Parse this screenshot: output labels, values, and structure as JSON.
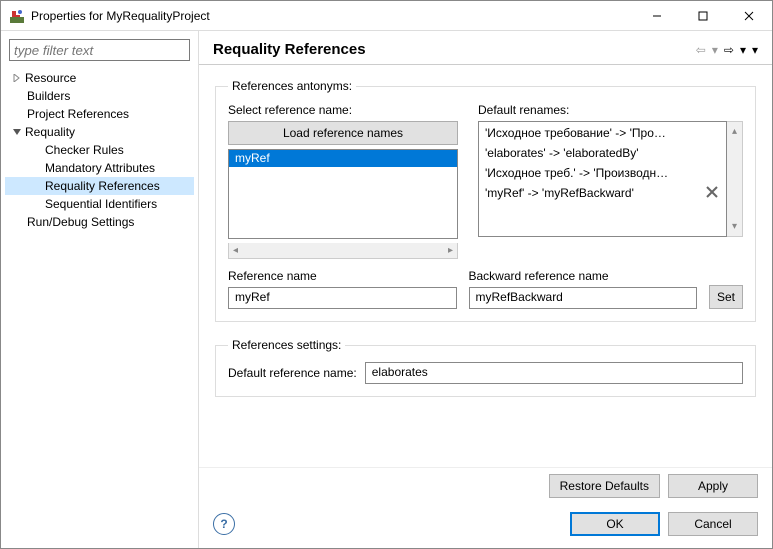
{
  "window": {
    "title": "Properties for MyRequalityProject",
    "minimize": "—",
    "maximize": "□",
    "close": "✕"
  },
  "filter": {
    "placeholder": "type filter text"
  },
  "tree": {
    "resource": "Resource",
    "builders": "Builders",
    "projectRefs": "Project References",
    "requality": "Requality",
    "checker": "Checker Rules",
    "mandatory": "Mandatory Attributes",
    "reqRefs": "Requality References",
    "seqIds": "Sequential Identifiers",
    "runDebug": "Run/Debug Settings"
  },
  "header": {
    "title": "Requality References"
  },
  "antonyms": {
    "legend": "References antonyms:",
    "selectLabel": "Select reference name:",
    "renamesLabel": "Default renames:",
    "loadBtn": "Load reference names",
    "items": [
      "myRef"
    ],
    "renames": [
      "'Исходное требование' -> 'Про…",
      "'elaborates' -> 'elaboratedBy'",
      "'Исходное треб.' -> 'Производн…",
      "'myRef' -> 'myRefBackward'"
    ],
    "refNameLabel": "Reference name",
    "backNameLabel": "Backward reference name",
    "refName": "myRef",
    "backName": "myRefBackward",
    "setBtn": "Set"
  },
  "settings": {
    "legend": "References settings:",
    "label": "Default reference name:",
    "value": "elaborates"
  },
  "buttons": {
    "restore": "Restore Defaults",
    "apply": "Apply",
    "ok": "OK",
    "cancel": "Cancel"
  }
}
